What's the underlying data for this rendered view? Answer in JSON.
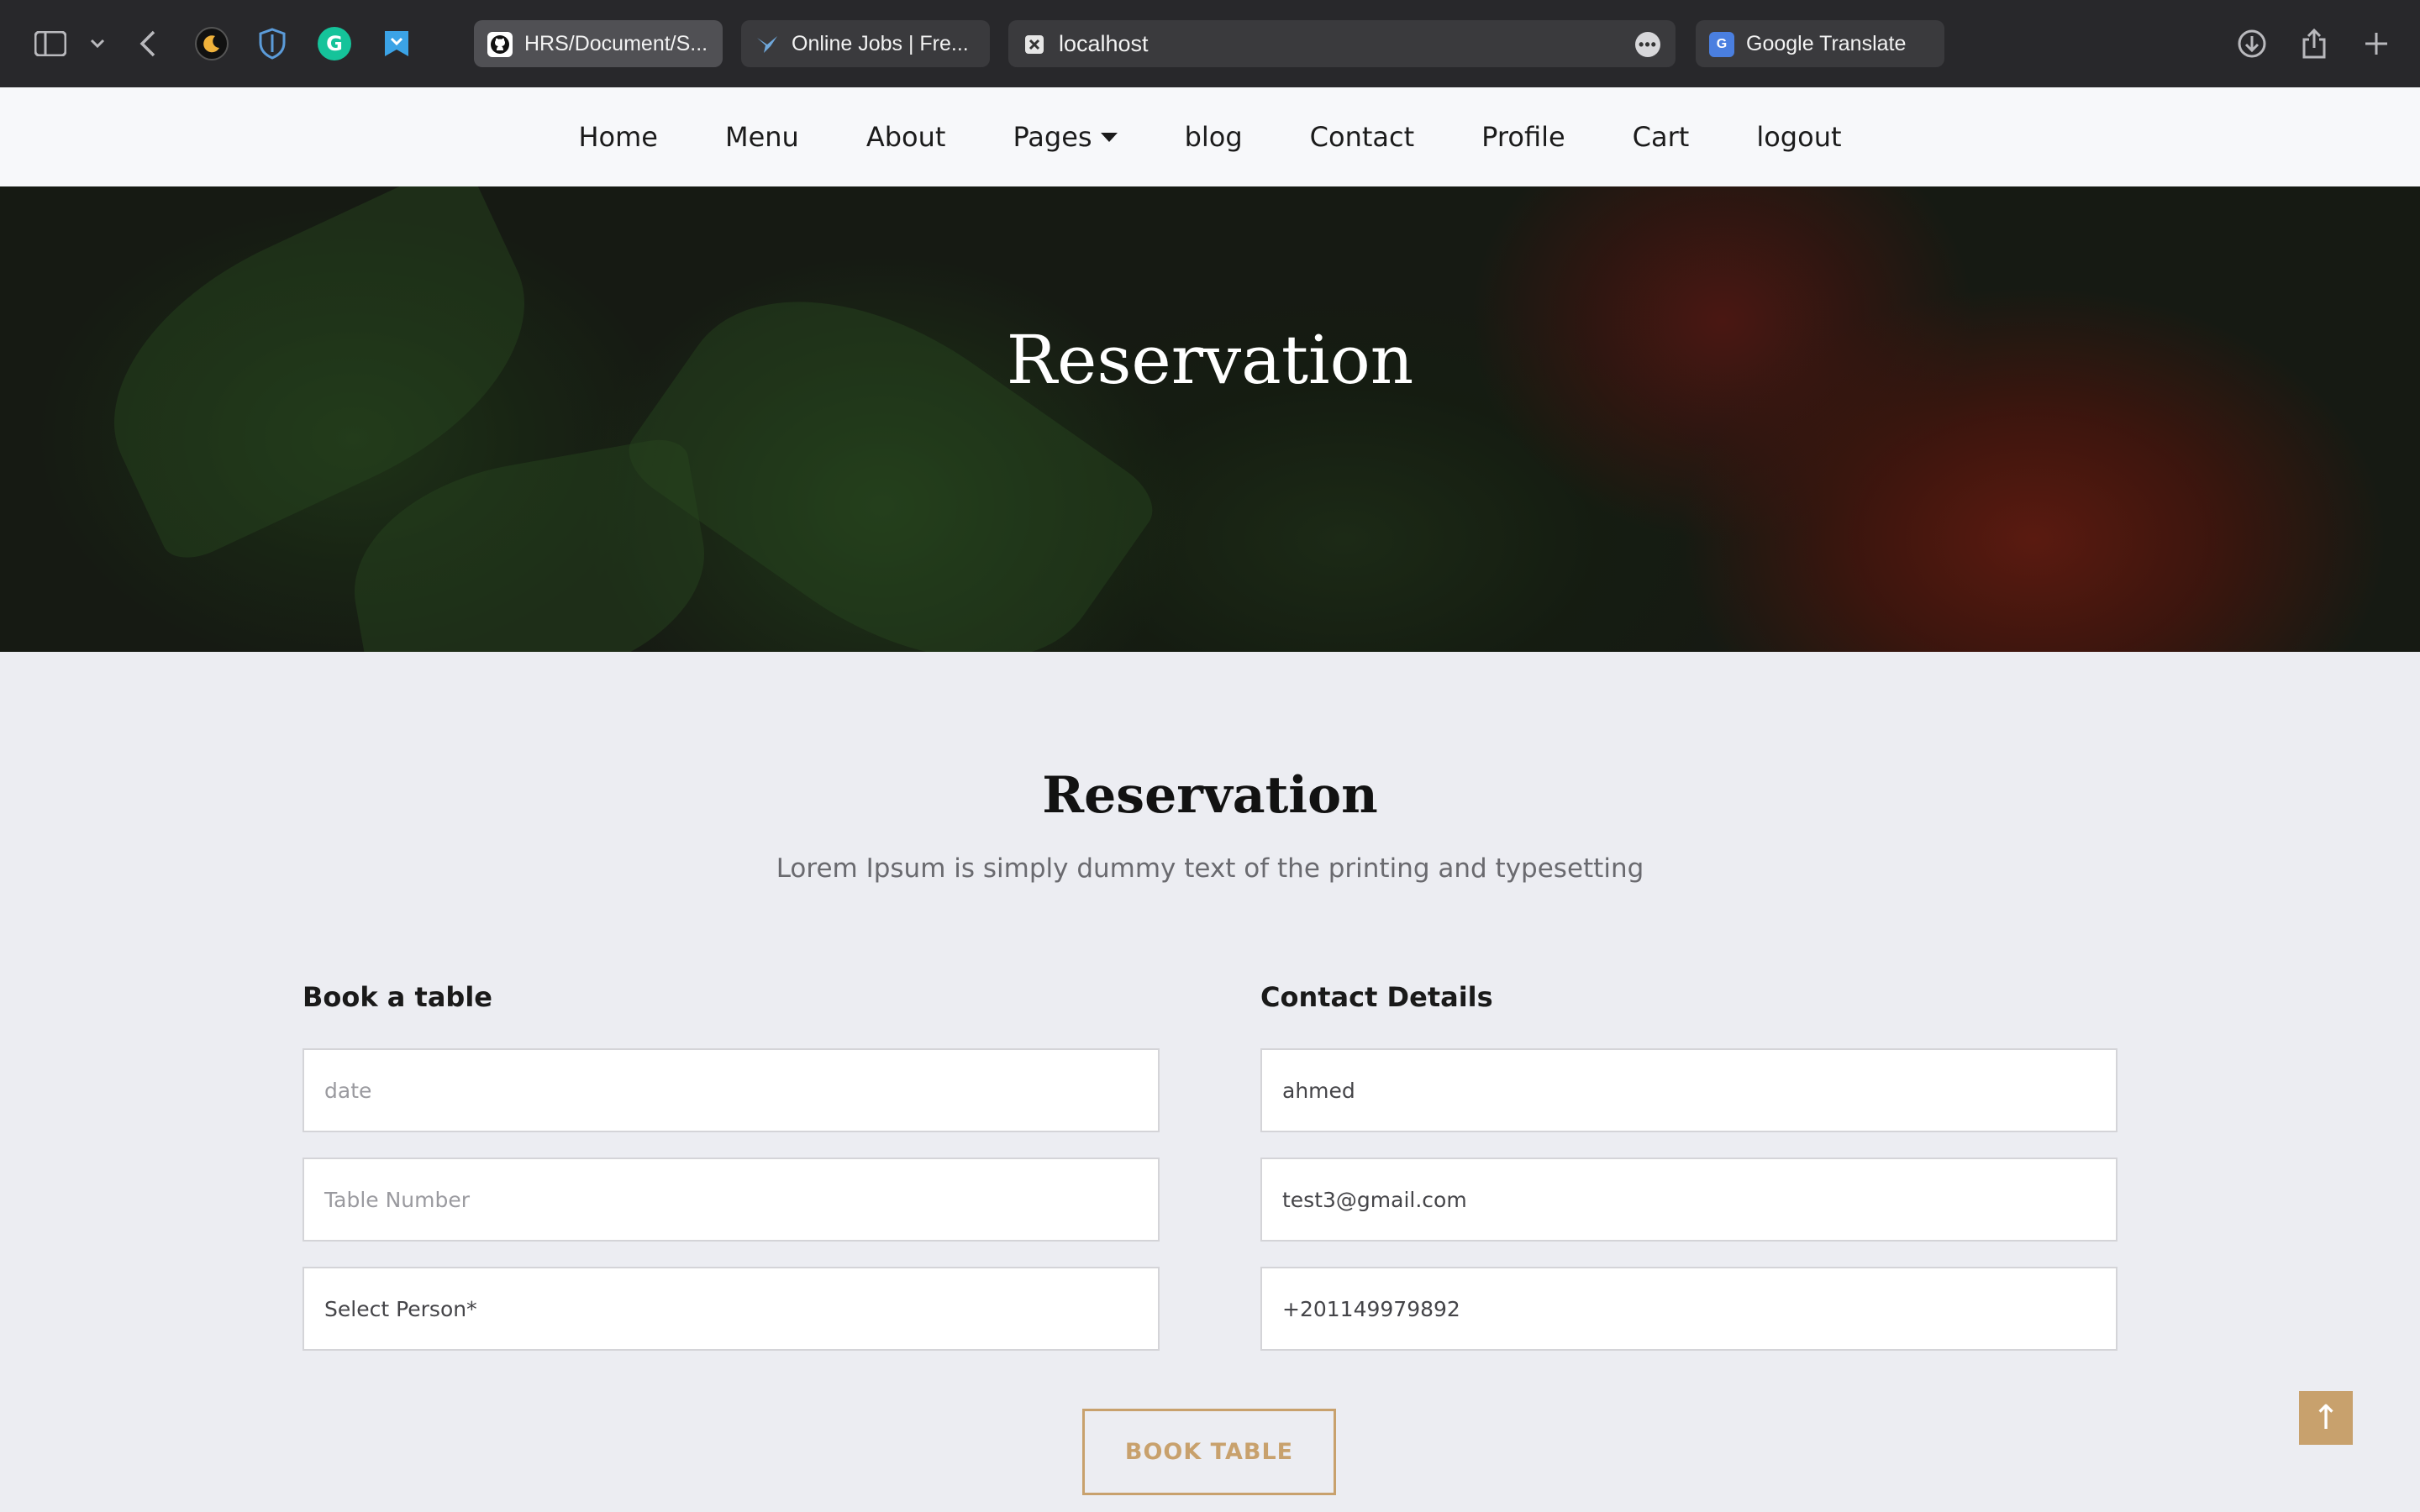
{
  "browser": {
    "tabs": [
      {
        "label": "HRS/Document/S...",
        "icon": "github-icon"
      },
      {
        "label": "Online Jobs | Fre...",
        "icon": "hummingbird-icon"
      },
      {
        "label": "localhost",
        "icon": "close-icon"
      },
      {
        "label": "Google Translate",
        "icon": "google-translate-icon"
      }
    ],
    "more_label": "•••"
  },
  "nav": {
    "items": [
      "Home",
      "Menu",
      "About",
      "Pages",
      "blog",
      "Contact",
      "Profile",
      "Cart",
      "logout"
    ]
  },
  "hero": {
    "title": "Reservation"
  },
  "section": {
    "title": "Reservation",
    "subtitle": "Lorem Ipsum is simply dummy text of the printing and typesetting"
  },
  "booking": {
    "heading": "Book a table",
    "date_placeholder": "date",
    "table_placeholder": "Table Number",
    "person_select": "Select Person*"
  },
  "contact": {
    "heading": "Contact Details",
    "name": "ahmed",
    "email": "test3@gmail.com",
    "phone": "+201149979892"
  },
  "actions": {
    "book_label": "BOOK TABLE",
    "top_label": "↑"
  },
  "colors": {
    "accent": "#c8a16d",
    "chrome": "#28282b",
    "page_bg": "#ecedf2"
  }
}
